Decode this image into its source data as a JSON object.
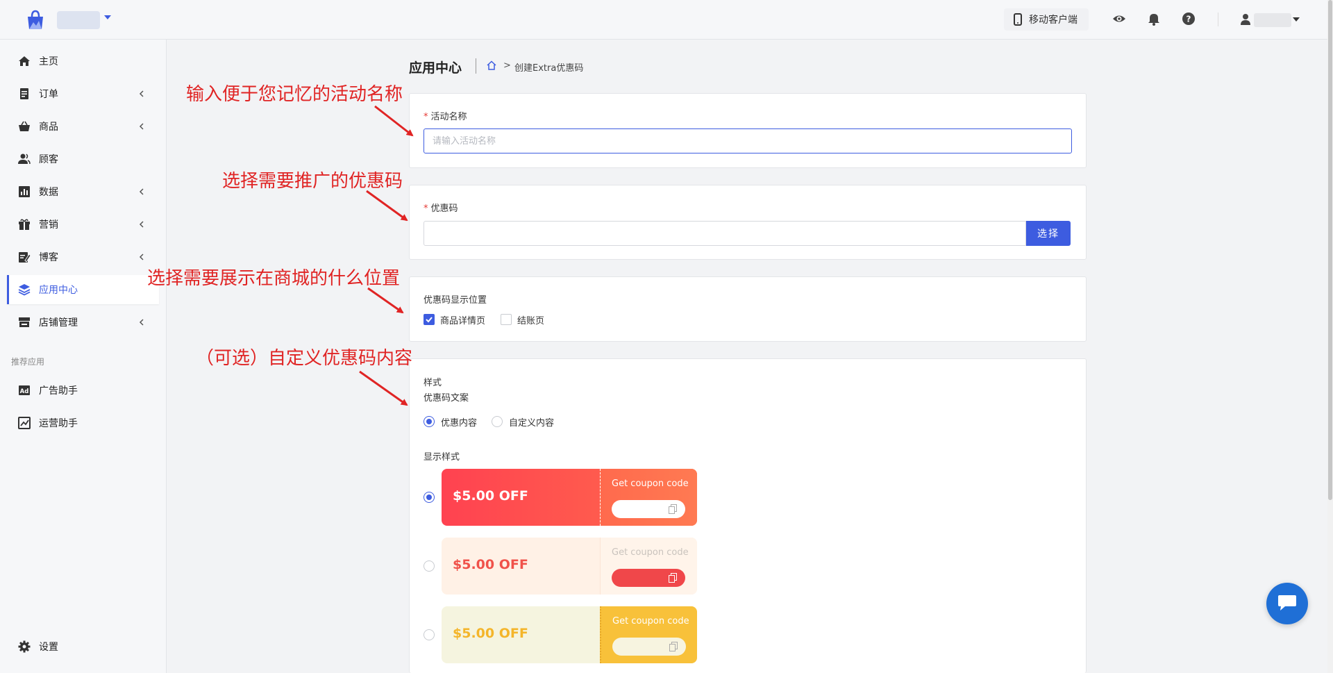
{
  "topbar": {
    "mobile_label": "移动客户端"
  },
  "sidebar": {
    "items": [
      {
        "label": "主页"
      },
      {
        "label": "订单"
      },
      {
        "label": "商品"
      },
      {
        "label": "顾客"
      },
      {
        "label": "数据"
      },
      {
        "label": "营销"
      },
      {
        "label": "博客"
      },
      {
        "label": "应用中心"
      },
      {
        "label": "店铺管理"
      }
    ],
    "section_label": "推荐应用",
    "apps": [
      {
        "label": "广告助手"
      },
      {
        "label": "运营助手"
      }
    ],
    "settings_label": "设置"
  },
  "page": {
    "title": "应用中心",
    "breadcrumb_sep": ">",
    "breadcrumb_current": "创建Extra优惠码"
  },
  "form": {
    "name_label": "活动名称",
    "name_placeholder": "请输入活动名称",
    "coupon_label": "优惠码",
    "select_button": "选择",
    "position_label": "优惠码显示位置",
    "position_options": [
      {
        "label": "商品详情页",
        "checked": true
      },
      {
        "label": "结账页",
        "checked": false
      }
    ],
    "style_label": "样式",
    "copy_label": "优惠码文案",
    "copy_options": [
      {
        "label": "优惠内容",
        "checked": true
      },
      {
        "label": "自定义内容",
        "checked": false
      }
    ],
    "display_style_label": "显示样式",
    "coupons": [
      {
        "amount": "$5.00 OFF",
        "cta": "Get coupon code",
        "selected": true
      },
      {
        "amount": "$5.00 OFF",
        "cta": "Get coupon code",
        "selected": false
      },
      {
        "amount": "$5.00 OFF",
        "cta": "Get coupon code",
        "selected": false
      }
    ]
  },
  "annotations": [
    "输入便于您记忆的活动名称",
    "选择需要推广的优惠码",
    "选择需要展示在商城的什么位置",
    "（可选）自定义优惠码内容"
  ],
  "colors": {
    "accent": "#3d5ce0",
    "annotation": "#e02424",
    "coupon1": "#ff4d4f",
    "coupon2_bg": "#fff1e6",
    "coupon3_bg": "#f5f4df",
    "coupon3_right": "#f8c13a"
  }
}
